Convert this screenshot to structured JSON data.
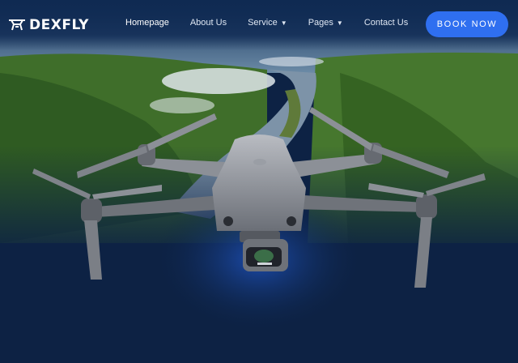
{
  "brand": {
    "name": "DEXFLY",
    "logo_icon": "drone-logo-icon"
  },
  "nav": {
    "items": [
      {
        "label": "Homepage",
        "active": true,
        "dropdown": false
      },
      {
        "label": "About Us",
        "active": false,
        "dropdown": false
      },
      {
        "label": "Service",
        "active": false,
        "dropdown": true
      },
      {
        "label": "Pages",
        "active": false,
        "dropdown": true
      },
      {
        "label": "Contact Us",
        "active": false,
        "dropdown": false
      }
    ],
    "cta": "BOOK NOW"
  },
  "colors": {
    "nav_bg": "#0f2a52",
    "accent": "#2f6ff0",
    "page_bg": "#0d2244"
  },
  "hero": {
    "image": "aerial river valley with grey quadcopter drone",
    "icon": "drone-image"
  }
}
